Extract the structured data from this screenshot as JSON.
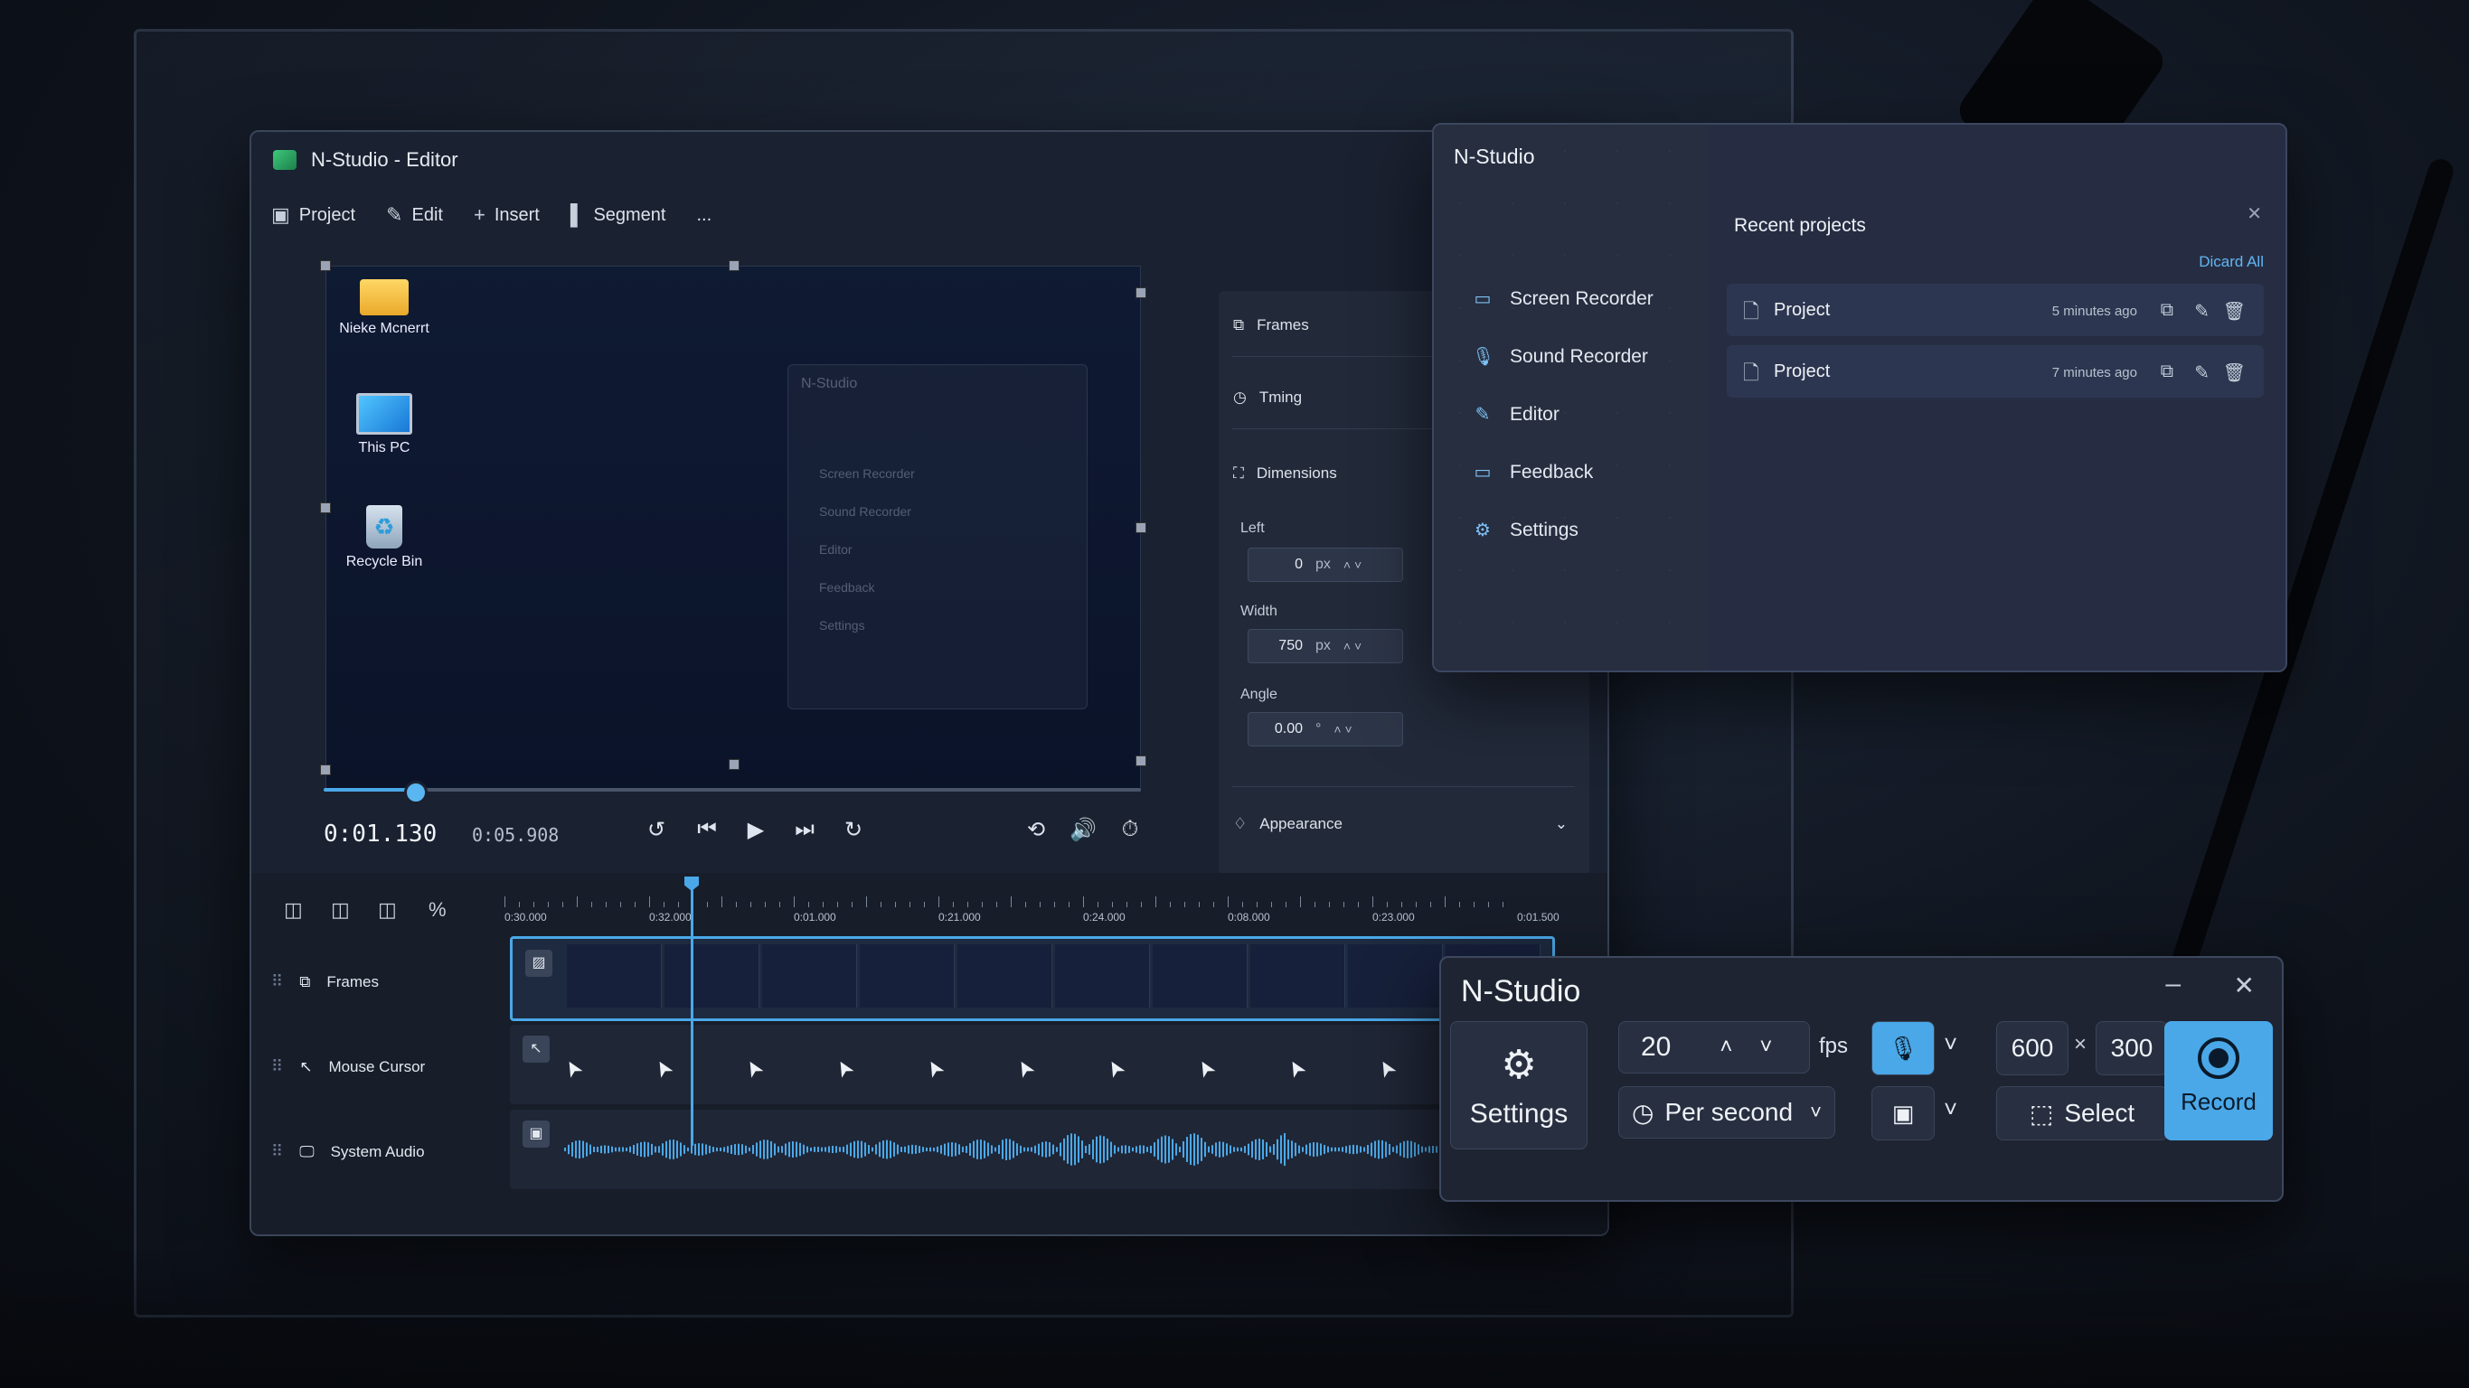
{
  "editor": {
    "title": "N-Studio - Editor",
    "toolbar": {
      "project": "Project",
      "edit": "Edit",
      "insert": "Insert",
      "segment": "Segment",
      "more": "..."
    },
    "desktop_icons": [
      "Nieke Mcnerrt",
      "This PC",
      "Recycle Bin"
    ],
    "ghost_window": {
      "title": "N-Studio",
      "items": [
        "Screen Recorder",
        "Sound Recorder",
        "Editor",
        "Feedback",
        "Settings"
      ]
    },
    "player": {
      "current_time": "0:01.130",
      "total_time": "0:05.908",
      "progress": 0.11
    },
    "properties": {
      "frames": "Frames",
      "timing": "Tming",
      "dimensions": "Dimensions",
      "left_label": "Left",
      "left_value": "0",
      "left_unit": "px",
      "width_label": "Width",
      "width_value": "750",
      "width_unit": "px",
      "angle_label": "Angle",
      "angle_value": "0.00",
      "angle_unit": "°",
      "appearance": "Appearance"
    },
    "timeline": {
      "zoom_icon": "%",
      "ticks": [
        "0:30.000",
        "0:32.000",
        "0:01.000",
        "0:21.000",
        "0:24.000",
        "0:08.000",
        "0:23.000",
        "0:01.500"
      ],
      "tracks": [
        "Frames",
        "Mouse Cursor",
        "System Audio"
      ]
    }
  },
  "home": {
    "title": "N-Studio",
    "nav": [
      "Screen Recorder",
      "Sound Recorder",
      "Editor",
      "Feedback",
      "Settings"
    ],
    "recent_title": "Recent projects",
    "discard_all": "Dicard All",
    "projects": [
      {
        "name": "Project",
        "ago": "5 minutes ago"
      },
      {
        "name": "Project",
        "ago": "7 minutes ago"
      }
    ]
  },
  "recorder": {
    "title": "N-Studio",
    "settings_label": "Settings",
    "fps_value": "20",
    "fps_unit": "fps",
    "frequency": "Per second",
    "width": "600",
    "times": "×",
    "height": "300",
    "select_label": "Select",
    "record_label": "Record"
  },
  "colors": {
    "accent": "#4aa8e8",
    "background": "#0f141d",
    "window": "#1a2130"
  }
}
